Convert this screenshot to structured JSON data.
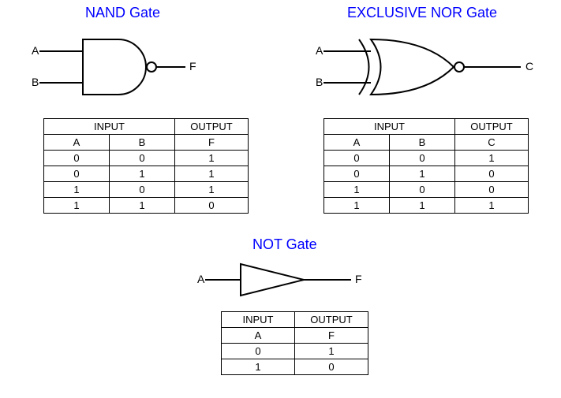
{
  "nand": {
    "title": "NAND Gate",
    "inputs": [
      "A",
      "B"
    ],
    "output": "F",
    "table": {
      "input_header": "INPUT",
      "output_header": "OUTPUT",
      "cols": [
        "A",
        "B",
        "F"
      ],
      "rows": [
        [
          "0",
          "0",
          "1"
        ],
        [
          "0",
          "1",
          "1"
        ],
        [
          "1",
          "0",
          "1"
        ],
        [
          "1",
          "1",
          "0"
        ]
      ]
    }
  },
  "xnor": {
    "title": "EXCLUSIVE NOR Gate",
    "inputs": [
      "A",
      "B"
    ],
    "output": "C",
    "table": {
      "input_header": "INPUT",
      "output_header": "OUTPUT",
      "cols": [
        "A",
        "B",
        "C"
      ],
      "rows": [
        [
          "0",
          "0",
          "1"
        ],
        [
          "0",
          "1",
          "0"
        ],
        [
          "1",
          "0",
          "0"
        ],
        [
          "1",
          "1",
          "1"
        ]
      ]
    }
  },
  "not": {
    "title": "NOT Gate",
    "input": "A",
    "output": "F",
    "table": {
      "input_header": "INPUT",
      "output_header": "OUTPUT",
      "cols": [
        "A",
        "F"
      ],
      "rows": [
        [
          "0",
          "1"
        ],
        [
          "1",
          "0"
        ]
      ]
    }
  },
  "chart_data": [
    {
      "type": "table",
      "title": "NAND Gate Truth Table",
      "columns": [
        "A",
        "B",
        "F"
      ],
      "rows": [
        [
          0,
          0,
          1
        ],
        [
          0,
          1,
          1
        ],
        [
          1,
          0,
          1
        ],
        [
          1,
          1,
          0
        ]
      ]
    },
    {
      "type": "table",
      "title": "EXCLUSIVE NOR Gate Truth Table",
      "columns": [
        "A",
        "B",
        "C"
      ],
      "rows": [
        [
          0,
          0,
          1
        ],
        [
          0,
          1,
          0
        ],
        [
          1,
          0,
          0
        ],
        [
          1,
          1,
          1
        ]
      ]
    },
    {
      "type": "table",
      "title": "NOT Gate Truth Table",
      "columns": [
        "A",
        "F"
      ],
      "rows": [
        [
          0,
          1
        ],
        [
          1,
          0
        ]
      ]
    }
  ]
}
